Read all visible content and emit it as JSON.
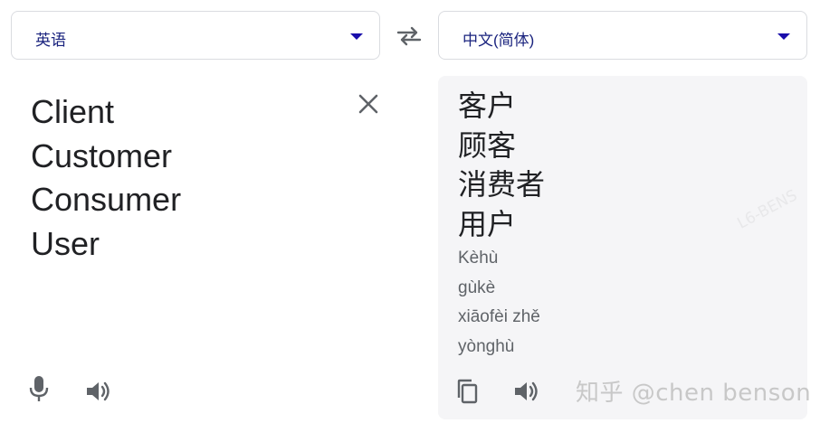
{
  "source_language": {
    "label": "英语",
    "icon": "chevron-down-icon"
  },
  "target_language": {
    "label": "中文(简体)",
    "icon": "chevron-down-icon"
  },
  "swap_icon": "swap-arrows-icon",
  "source": {
    "words": [
      "Client",
      "Customer",
      "Consumer",
      "User"
    ],
    "clear_icon": "close-icon",
    "mic_icon": "mic-icon",
    "speak_icon": "speaker-icon"
  },
  "target": {
    "words": [
      "客户",
      "顾客",
      "消费者",
      "用户"
    ],
    "pinyin": [
      "Kèhù",
      "gùkè",
      "xiāofèi zhě",
      "yònghù"
    ],
    "copy_icon": "copy-icon",
    "speak_icon": "speaker-icon"
  },
  "watermark": "知乎 @chen benson",
  "watermark_faint": "L6-BENS",
  "colors": {
    "accent": "#1a0dab",
    "icon": "#5f6368",
    "panel": "#f5f5f7"
  }
}
